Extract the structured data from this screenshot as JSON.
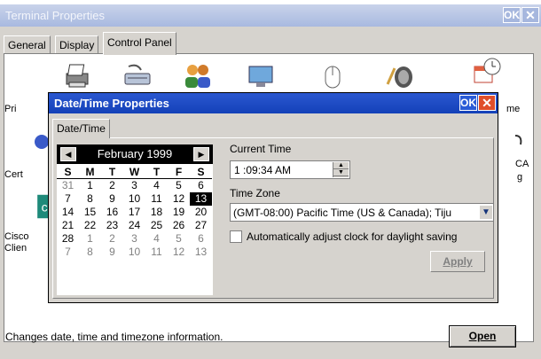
{
  "window": {
    "title": "Terminal Properties",
    "ok_label": "OK",
    "close_label": "✕",
    "tabs": [
      "General",
      "Display",
      "Control Panel"
    ],
    "active_tab": "Control Panel"
  },
  "control_panel": {
    "visible_label_fragments": [
      "Pri",
      "Cert",
      "Cisco",
      "Clien",
      "me",
      "CA",
      "g"
    ]
  },
  "status_text": "Changes date, time and timezone information.",
  "open_button": "Open",
  "dialog": {
    "title": "Date/Time Properties",
    "ok_label": "OK",
    "close_label": "✕",
    "tab": "Date/Time",
    "calendar": {
      "month_year": "February 1999",
      "prev_icon": "◀",
      "next_icon": "▶",
      "weekdays": [
        "S",
        "M",
        "T",
        "W",
        "T",
        "F",
        "S"
      ],
      "weeks": [
        [
          "31",
          "1",
          "2",
          "3",
          "4",
          "5",
          "6"
        ],
        [
          "7",
          "8",
          "9",
          "10",
          "11",
          "12",
          "13"
        ],
        [
          "14",
          "15",
          "16",
          "17",
          "18",
          "19",
          "20"
        ],
        [
          "21",
          "22",
          "23",
          "24",
          "25",
          "26",
          "27"
        ],
        [
          "28",
          "1",
          "2",
          "3",
          "4",
          "5",
          "6"
        ],
        [
          "7",
          "8",
          "9",
          "10",
          "11",
          "12",
          "13"
        ]
      ],
      "selected": "13"
    },
    "current_time_label": "Current Time",
    "time_value": "1 :09:34 AM",
    "time_zone_label": "Time Zone",
    "time_zone_value": "(GMT-08:00) Pacific Time (US & Canada); Tiju",
    "daylight_label": "Automatically adjust clock for daylight saving",
    "apply_label": "Apply"
  }
}
